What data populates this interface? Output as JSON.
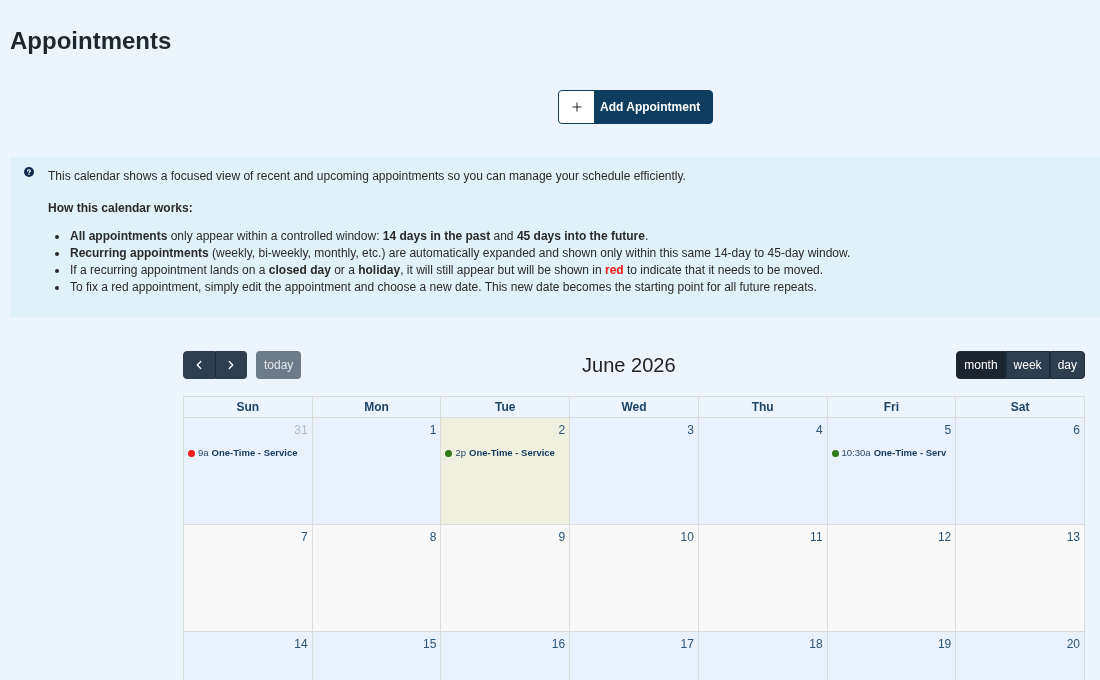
{
  "page": {
    "title": "Appointments"
  },
  "add_button": {
    "label": "Add Appointment"
  },
  "info": {
    "intro": "This calendar shows a focused view of recent and upcoming appointments so you can manage your schedule efficiently.",
    "heading": "How this calendar works:",
    "bullets": [
      {
        "parts": [
          {
            "kind": "text",
            "text": "**All appointments** only appear within a controlled window: **14 days in the past** and **45 days into the future**."
          }
        ]
      },
      {
        "parts": [
          {
            "kind": "text",
            "text": "**Recurring appointments** (weekly, bi-weekly, monthly, etc.) are automatically expanded and shown only within this same 14-day to 45-day window."
          }
        ]
      },
      {
        "parts": [
          {
            "kind": "text",
            "text": "If a recurring appointment lands on a **closed day** or a **holiday**, it will still appear but will be shown in "
          },
          {
            "kind": "alert",
            "text": "red"
          },
          {
            "kind": "text",
            "text": " to indicate that it needs to be moved."
          }
        ]
      },
      {
        "parts": [
          {
            "kind": "text",
            "text": "To fix a red appointment, simply edit the appointment and choose a new date. This new date becomes the starting point for all future repeats."
          }
        ]
      }
    ]
  },
  "calendar": {
    "title": "June 2026",
    "today_button": {
      "label": "today",
      "disabled": true
    },
    "views": [
      {
        "label": "month",
        "selected": true
      },
      {
        "label": "week",
        "selected": false
      },
      {
        "label": "day",
        "selected": false
      }
    ],
    "weekdays": [
      "Sun",
      "Mon",
      "Tue",
      "Wed",
      "Thu",
      "Fri",
      "Sat"
    ],
    "weeks": [
      {
        "shaded": false,
        "days": [
          {
            "number": "31",
            "other_month": true,
            "today": false,
            "events": [
              {
                "time": "9a",
                "title": "One-Time - Service",
                "color": "#ee1c1c"
              }
            ]
          },
          {
            "number": "1",
            "other_month": false,
            "today": false
          },
          {
            "number": "2",
            "other_month": false,
            "today": true,
            "events": [
              {
                "time": "2p",
                "title": "One-Time - Service",
                "color": "#2f7a14"
              }
            ]
          },
          {
            "number": "3",
            "other_month": false,
            "today": false
          },
          {
            "number": "4",
            "other_month": false,
            "today": false
          },
          {
            "number": "5",
            "other_month": false,
            "today": false,
            "events": [
              {
                "time": "10:30a",
                "title": "One-Time - Serv",
                "color": "#2f7a14"
              }
            ]
          },
          {
            "number": "6",
            "other_month": false,
            "today": false
          }
        ]
      },
      {
        "shaded": true,
        "days": [
          {
            "number": "7",
            "other_month": false,
            "today": false
          },
          {
            "number": "8",
            "other_month": false,
            "today": false
          },
          {
            "number": "9",
            "other_month": false,
            "today": false
          },
          {
            "number": "10",
            "other_month": false,
            "today": false
          },
          {
            "number": "11",
            "other_month": false,
            "today": false
          },
          {
            "number": "12",
            "other_month": false,
            "today": false
          },
          {
            "number": "13",
            "other_month": false,
            "today": false
          }
        ]
      },
      {
        "shaded": false,
        "days": [
          {
            "number": "14",
            "other_month": false,
            "today": false
          },
          {
            "number": "15",
            "other_month": false,
            "today": false
          },
          {
            "number": "16",
            "other_month": false,
            "today": false
          },
          {
            "number": "17",
            "other_month": false,
            "today": false
          },
          {
            "number": "18",
            "other_month": false,
            "today": false
          },
          {
            "number": "19",
            "other_month": false,
            "today": false
          },
          {
            "number": "20",
            "other_month": false,
            "today": false
          }
        ]
      }
    ]
  }
}
